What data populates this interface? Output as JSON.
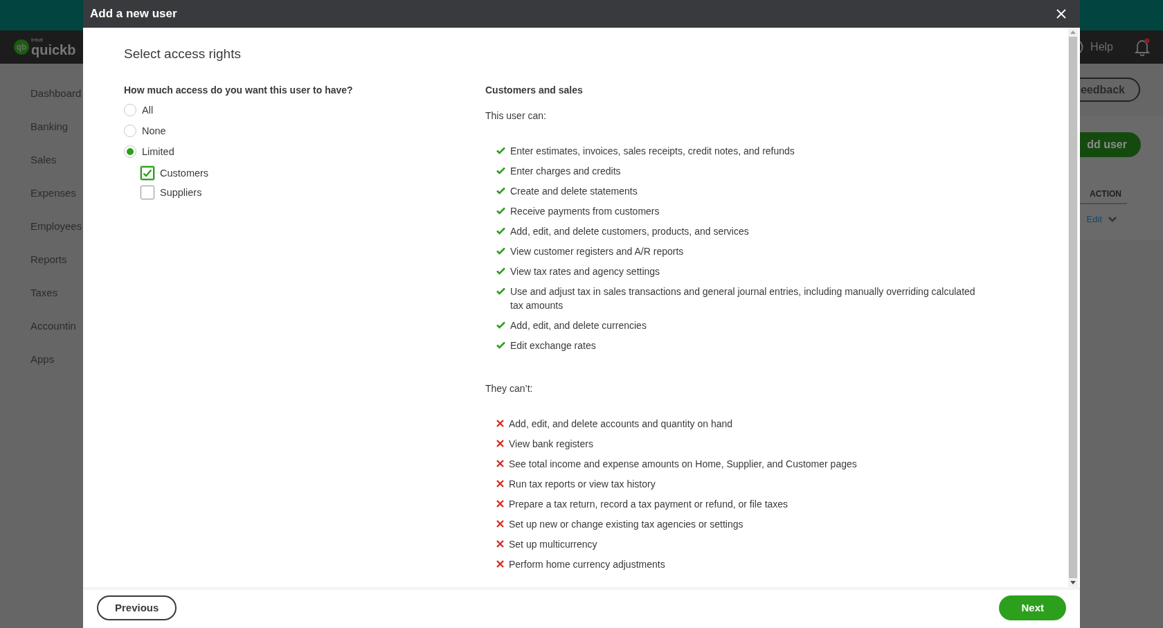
{
  "background": {
    "logo_brand": "intuit",
    "logo_mark": "qb",
    "logo_text": "quickb",
    "nav": [
      "Dashboard",
      "Banking",
      "Sales",
      "Expenses",
      "Employees",
      "Reports",
      "Taxes",
      "Accountin",
      "Apps"
    ],
    "help": "Help",
    "feedback_button": "eedback",
    "add_user_button": "dd user",
    "table_header": "ACTION",
    "row_action": "Edit"
  },
  "dialog": {
    "title": "Add a new user",
    "heading": "Select access rights",
    "question": "How much access do you want this user to have?",
    "access_options": [
      {
        "label": "All",
        "selected": false
      },
      {
        "label": "None",
        "selected": false
      },
      {
        "label": "Limited",
        "selected": true
      }
    ],
    "areas": [
      {
        "label": "Customers",
        "checked": true
      },
      {
        "label": "Suppliers",
        "checked": false
      }
    ],
    "section_title": "Customers and sales",
    "can_intro": "This user can:",
    "can": [
      "Enter estimates, invoices, sales receipts, credit notes, and refunds",
      "Enter charges and credits",
      "Create and delete statements",
      "Receive payments from customers",
      "Add, edit, and delete customers, products, and services",
      "View customer registers and A/R reports",
      "View tax rates and agency settings",
      "Use and adjust tax in sales transactions and general journal entries, including manually overriding calculated tax amounts",
      "Add, edit, and delete currencies",
      "Edit exchange rates"
    ],
    "cant_intro": "They can’t:",
    "cant": [
      "Add, edit, and delete accounts and quantity on hand",
      "View bank registers",
      "See total income and expense amounts on Home, Supplier, and Customer pages",
      "Run tax reports or view tax history",
      "Prepare a tax return, record a tax payment or refund, or file taxes",
      "Set up new or change existing tax agencies or settings",
      "Set up multicurrency",
      "Perform home currency adjustments"
    ],
    "previous_button": "Previous",
    "next_button": "Next"
  }
}
